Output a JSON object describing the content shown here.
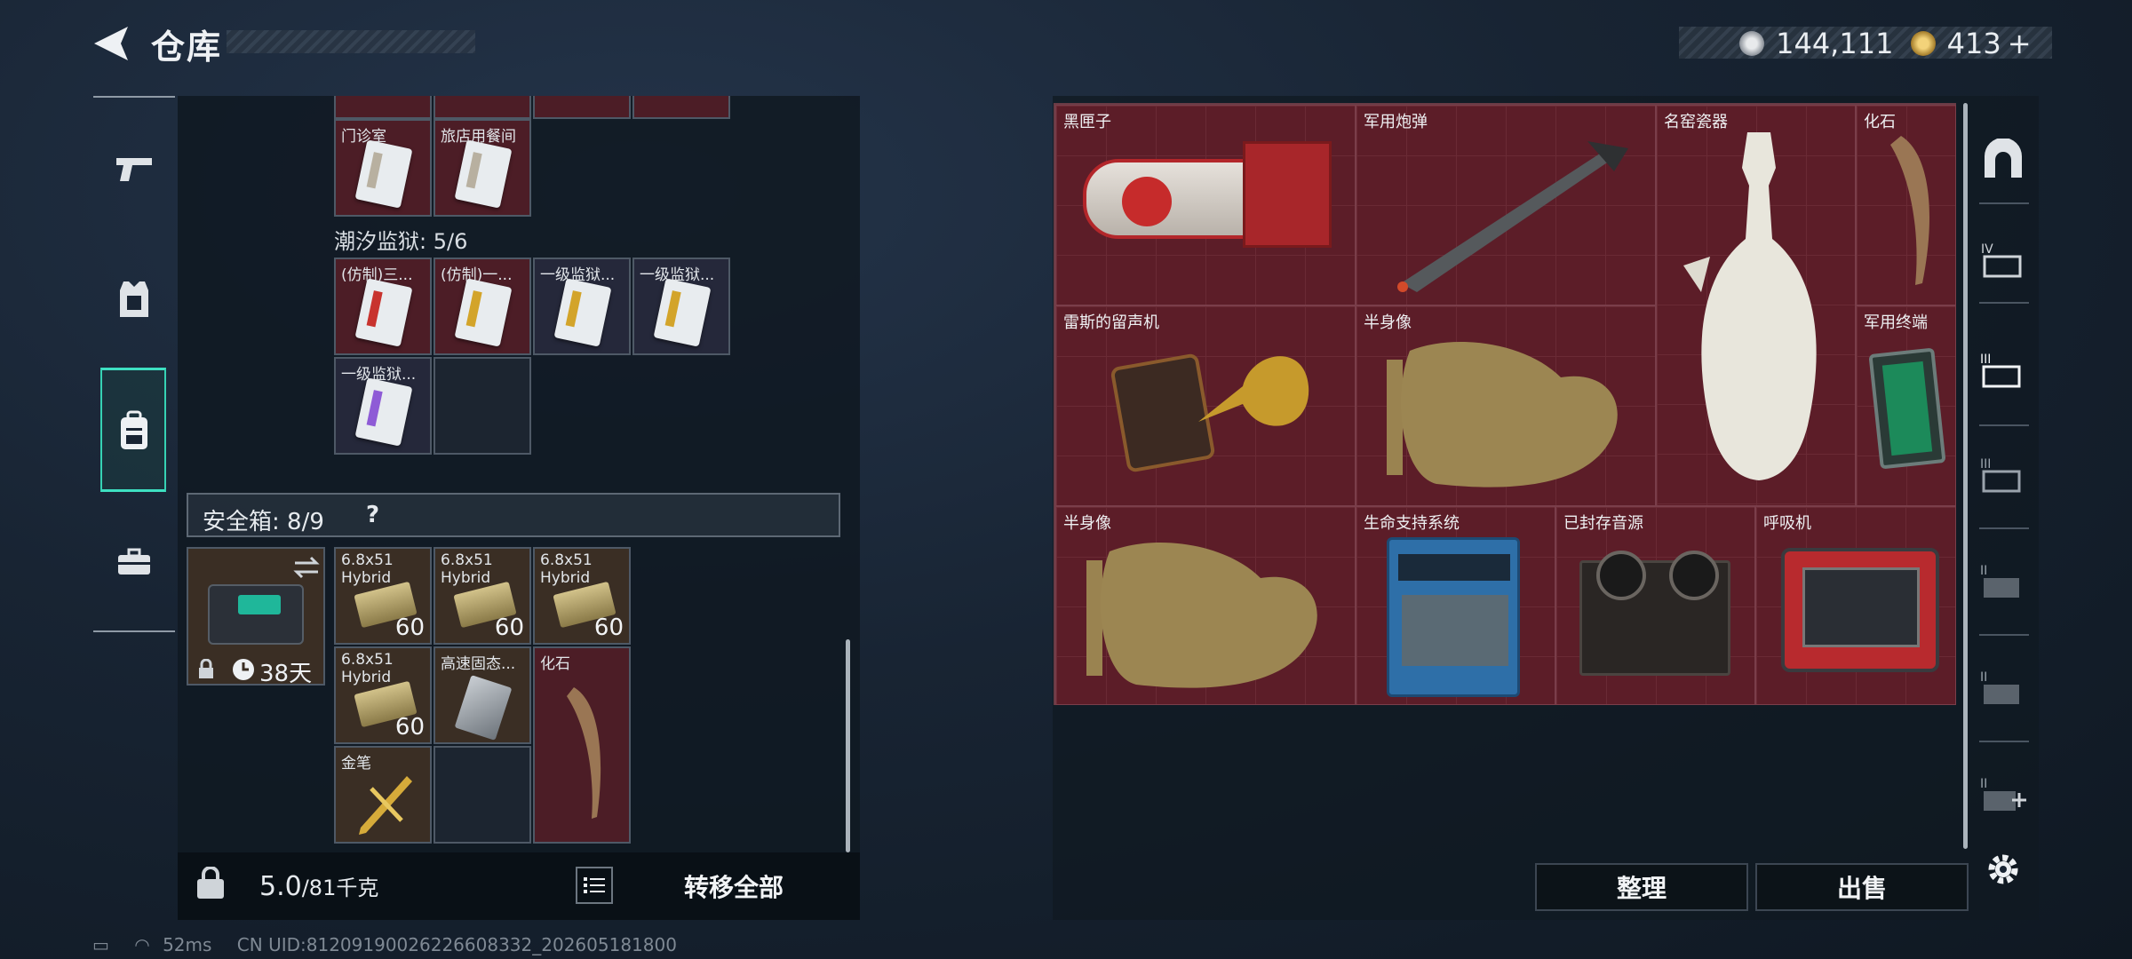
{
  "header": {
    "title": "仓库",
    "currency": [
      {
        "icon": "silver-coin-icon",
        "value": "144,111"
      },
      {
        "icon": "gold-coin-icon",
        "value": "413"
      },
      {
        "icon": "plus-icon",
        "value": "+"
      }
    ]
  },
  "left_rail": [
    "pistol-icon",
    "armor-vest-icon",
    "backpack-icon",
    "toolbox-icon"
  ],
  "left_panel": {
    "top_partial_row": [
      {
        "label": "门诊室",
        "color": "#4c1d26"
      },
      {
        "label": "旅店用餐间",
        "color": "#4c1d26"
      }
    ],
    "group": {
      "title": "潮汐监狱: 5/6",
      "items": [
        {
          "label": "(仿制)三...",
          "stripe": "#c8332e"
        },
        {
          "label": "(仿制)一...",
          "stripe": "#c8332e"
        },
        {
          "label": "一级监狱...",
          "stripe": "#d3a42a"
        },
        {
          "label": "一级监狱...",
          "stripe": "#d3a42a"
        },
        {
          "label": "一级监狱...",
          "stripe": "#8e5bd6"
        }
      ]
    },
    "safe_box": {
      "title": "安全箱: 8/9",
      "help": "?",
      "timer": "38天",
      "items": [
        {
          "label": "6.8x51 Hybrid",
          "count": "60"
        },
        {
          "label": "6.8x51 Hybrid",
          "count": "60"
        },
        {
          "label": "6.8x51 Hybrid",
          "count": "60"
        },
        {
          "label": "6.8x51 Hybrid",
          "count": "60"
        },
        {
          "label": "高速固态...",
          "count": ""
        },
        {
          "label": "化石",
          "count": ""
        },
        {
          "label": "金笔",
          "count": ""
        }
      ]
    },
    "bottom": {
      "weight": "5.0",
      "weight_max": "/81千克",
      "transfer_all": "转移全部"
    }
  },
  "right_panel": {
    "items": [
      {
        "label": "黑匣子"
      },
      {
        "label": "军用炮弹"
      },
      {
        "label": "名窑瓷器"
      },
      {
        "label": "化石"
      },
      {
        "label": "雷斯的留声机"
      },
      {
        "label": "半身像"
      },
      {
        "label": "军用终端"
      },
      {
        "label": "半身像"
      },
      {
        "label": "生命支持系统"
      },
      {
        "label": "已封存音源"
      },
      {
        "label": "呼吸机"
      }
    ],
    "sort_button": "整理",
    "sell_button": "出售"
  },
  "right_rail": [
    "safe-arch-icon",
    "storage-iv-icon",
    "storage-iii-active-icon",
    "storage-iii-icon",
    "storage-ii-icon",
    "storage-ii-b-icon",
    "storage-add-icon",
    "settings-gear-icon"
  ],
  "status_bar": {
    "ping": "52ms",
    "uid": "CN UID:81209190026226608332_202605181800"
  },
  "colors": {
    "accent": "#3ee0c2",
    "item_red": "#5c1d28",
    "panel": "#101922"
  }
}
